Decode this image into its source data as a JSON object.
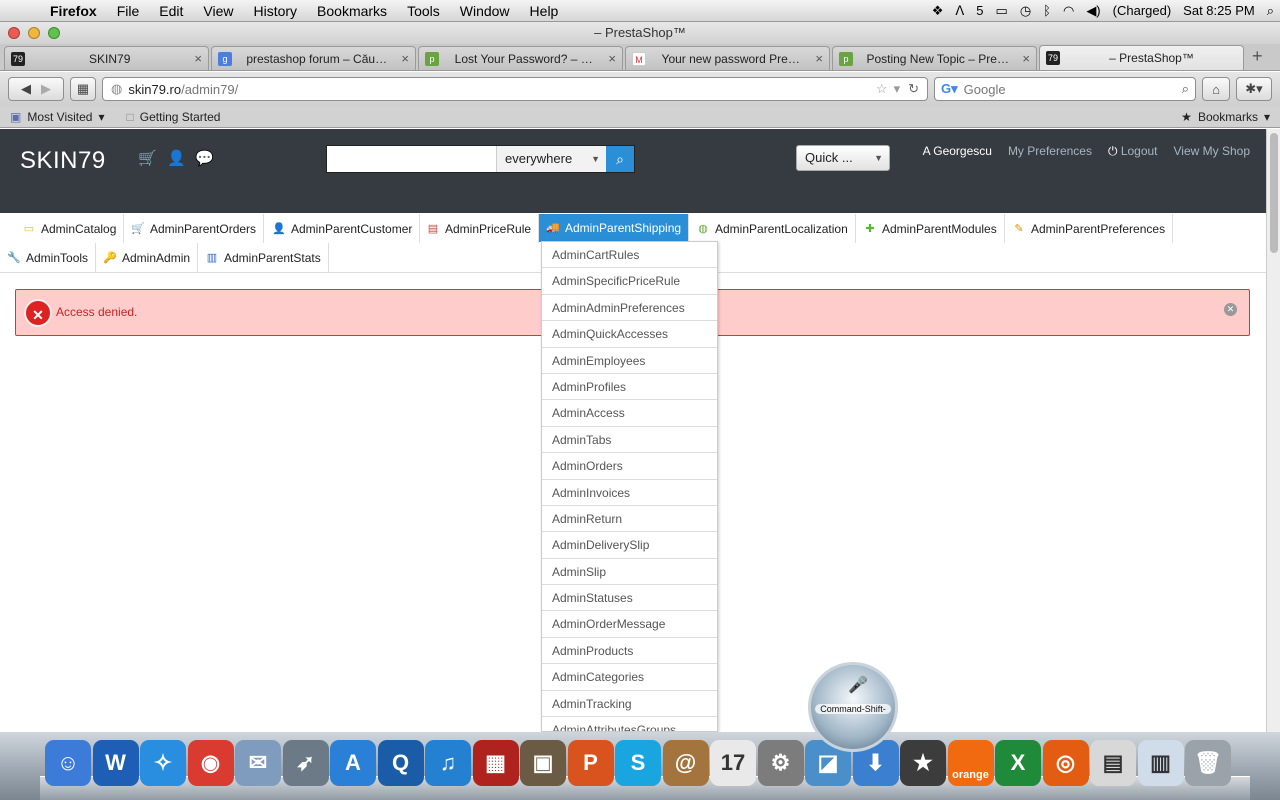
{
  "menubar": {
    "app": "Firefox",
    "items": [
      "File",
      "Edit",
      "View",
      "History",
      "Bookmarks",
      "Tools",
      "Window",
      "Help"
    ],
    "status": {
      "badge": "5",
      "battery": "(Charged)",
      "clock": "Sat 8:25 PM"
    }
  },
  "window": {
    "title": "– PrestaShop™"
  },
  "tabs": [
    {
      "label": "SKIN79",
      "favicon": "79"
    },
    {
      "label": "prestashop forum – Cău…",
      "favicon": "g"
    },
    {
      "label": "Lost Your Password? – …",
      "favicon": "p"
    },
    {
      "label": "Your new password Pre…",
      "favicon": "M"
    },
    {
      "label": "Posting New Topic – Pre…",
      "favicon": "p"
    },
    {
      "label": "– PrestaShop™",
      "favicon": "79"
    }
  ],
  "navbar": {
    "url_host": "skin79.ro",
    "url_path": "/admin79/",
    "search_placeholder": "Google"
  },
  "bookmarks": {
    "most_visited": "Most Visited",
    "getting_started": "Getting Started",
    "bookmarks_menu": "Bookmarks"
  },
  "header": {
    "brand": "SKIN79",
    "search_scope": "everywhere",
    "quick": "Quick ...",
    "user": "A Georgescu",
    "preferences": "My Preferences",
    "logout": "Logout",
    "view_shop": "View My Shop"
  },
  "admin_tabs": [
    {
      "label": "AdminCatalog"
    },
    {
      "label": "AdminParentOrders"
    },
    {
      "label": "AdminParentCustomer"
    },
    {
      "label": "AdminPriceRule"
    },
    {
      "label": "AdminParentShipping"
    },
    {
      "label": "AdminParentLocalization"
    },
    {
      "label": "AdminParentModules"
    },
    {
      "label": "AdminParentPreferences"
    },
    {
      "label": "AdminTools"
    },
    {
      "label": "AdminAdmin"
    },
    {
      "label": "AdminParentStats"
    }
  ],
  "alert": {
    "message": "Access denied."
  },
  "dropdown": [
    "AdminCartRules",
    "AdminSpecificPriceRule",
    "AdminAdminPreferences",
    "AdminQuickAccesses",
    "AdminEmployees",
    "AdminProfiles",
    "AdminAccess",
    "AdminTabs",
    "AdminOrders",
    "AdminInvoices",
    "AdminReturn",
    "AdminDeliverySlip",
    "AdminSlip",
    "AdminStatuses",
    "AdminOrderMessage",
    "AdminProducts",
    "AdminCategories",
    "AdminTracking",
    "AdminAttributesGroups"
  ],
  "hud": {
    "label": "Command-Shift-"
  },
  "dock_items": [
    {
      "name": "finder",
      "color": "#3d7bd8",
      "glyph": "☺"
    },
    {
      "name": "word",
      "color": "#1e5fb5",
      "glyph": "W"
    },
    {
      "name": "safari",
      "color": "#2a8ee0",
      "glyph": "✧"
    },
    {
      "name": "chrome",
      "color": "#d93b30",
      "glyph": "◉"
    },
    {
      "name": "mail-stamp",
      "color": "#7f9bbd",
      "glyph": "✉"
    },
    {
      "name": "launchpad",
      "color": "#6c7a88",
      "glyph": "➶"
    },
    {
      "name": "app-store",
      "color": "#2a7fd6",
      "glyph": "A"
    },
    {
      "name": "quicktime",
      "color": "#1b5ca8",
      "glyph": "Q"
    },
    {
      "name": "itunes",
      "color": "#2480d0",
      "glyph": "♫"
    },
    {
      "name": "photo-booth",
      "color": "#b0221e",
      "glyph": "▦"
    },
    {
      "name": "iphoto",
      "color": "#6b5a44",
      "glyph": "▣"
    },
    {
      "name": "powerpoint",
      "color": "#d9531e",
      "glyph": "P"
    },
    {
      "name": "skype",
      "color": "#19a6e0",
      "glyph": "S"
    },
    {
      "name": "address-book",
      "color": "#a4743e",
      "glyph": "@"
    },
    {
      "name": "calendar",
      "color": "#e9e9e9",
      "glyph": "17"
    },
    {
      "name": "system-preferences",
      "color": "#7c7c7c",
      "glyph": "⚙"
    },
    {
      "name": "preview",
      "color": "#4a8fc9",
      "glyph": "◪"
    },
    {
      "name": "downloads",
      "color": "#3a7fd0",
      "glyph": "⬇"
    },
    {
      "name": "imovie",
      "color": "#3c3c3c",
      "glyph": "★"
    },
    {
      "name": "orange",
      "color": "#f26a10",
      "glyph": "orange"
    },
    {
      "name": "excel",
      "color": "#1f8a3a",
      "glyph": "X"
    },
    {
      "name": "firefox",
      "color": "#e25c12",
      "glyph": "◎"
    },
    {
      "name": "documents",
      "color": "#d8d8d8",
      "glyph": "▤"
    },
    {
      "name": "word-doc",
      "color": "#d0dcea",
      "glyph": "▥"
    },
    {
      "name": "trash",
      "color": "#9aa2aa",
      "glyph": "🗑"
    }
  ]
}
